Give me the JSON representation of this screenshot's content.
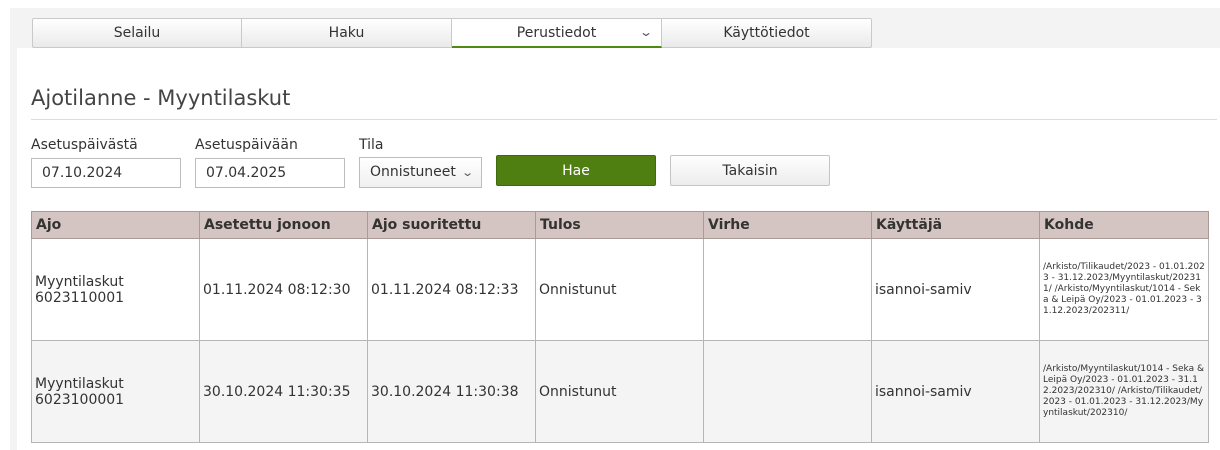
{
  "tabs": [
    {
      "label": "Selailu"
    },
    {
      "label": "Haku"
    },
    {
      "label": "Perustiedot"
    },
    {
      "label": "Käyttötiedot"
    }
  ],
  "page": {
    "title": "Ajotilanne - Myyntilaskut"
  },
  "filters": {
    "from_label": "Asetuspäivästä",
    "from_value": "07.10.2024",
    "to_label": "Asetuspäivään",
    "to_value": "07.04.2025",
    "status_label": "Tila",
    "status_value": "Onnistuneet"
  },
  "buttons": {
    "search": "Hae",
    "back": "Takaisin"
  },
  "table": {
    "headers": [
      "Ajo",
      "Asetettu jonoon",
      "Ajo suoritettu",
      "Tulos",
      "Virhe",
      "Käyttäjä",
      "Kohde"
    ],
    "rows": [
      {
        "ajo_line1": "Myyntilaskut",
        "ajo_line2": "6023110001",
        "queued": "01.11.2024 08:12:30",
        "executed": "01.11.2024 08:12:33",
        "result": "Onnistunut",
        "error": "",
        "user": "isannoi-samiv",
        "target": "/Arkisto/Tilikaudet/2023 - 01.01.2023 - 31.12.2023/Myyntilaskut/202311/ /Arkisto/Myyntilaskut/1014 - Seka & Leipä Oy/2023 - 01.01.2023 - 31.12.2023/202311/"
      },
      {
        "ajo_line1": "Myyntilaskut",
        "ajo_line2": "6023100001",
        "queued": "30.10.2024 11:30:35",
        "executed": "30.10.2024 11:30:38",
        "result": "Onnistunut",
        "error": "",
        "user": "isannoi-samiv",
        "target": "/Arkisto/Myyntilaskut/1014 - Seka & Leipä Oy/2023 - 01.01.2023 - 31.12.2023/202310/ /Arkisto/Tilikaudet/2023 - 01.01.2023 - 31.12.2023/Myyntilaskut/202310/"
      }
    ]
  },
  "icons": {
    "dropdown": "chevron-down-icon"
  },
  "colors": {
    "primary_button": "#4f7f10",
    "header_bg": "#d4c4c2",
    "active_tab_underline": "#4e8a10"
  }
}
